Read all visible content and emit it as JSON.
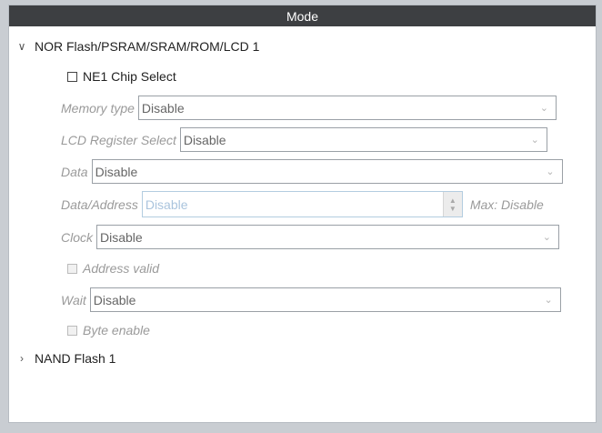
{
  "header": {
    "title": "Mode"
  },
  "nor_section": {
    "label": "NOR Flash/PSRAM/SRAM/ROM/LCD 1",
    "chip_select_label": "NE1 Chip Select",
    "memory_type": {
      "label": "Memory type",
      "value": "Disable"
    },
    "lcd_register_select": {
      "label": "LCD Register Select",
      "value": "Disable"
    },
    "data": {
      "label": "Data",
      "value": "Disable"
    },
    "data_address": {
      "label": "Data/Address",
      "value": "Disable",
      "max_text": "Max: Disable"
    },
    "clock": {
      "label": "Clock",
      "value": "Disable"
    },
    "address_valid_label": "Address valid",
    "wait": {
      "label": "Wait",
      "value": "Disable"
    },
    "byte_enable_label": "Byte enable"
  },
  "nand_section": {
    "label": "NAND Flash 1"
  }
}
